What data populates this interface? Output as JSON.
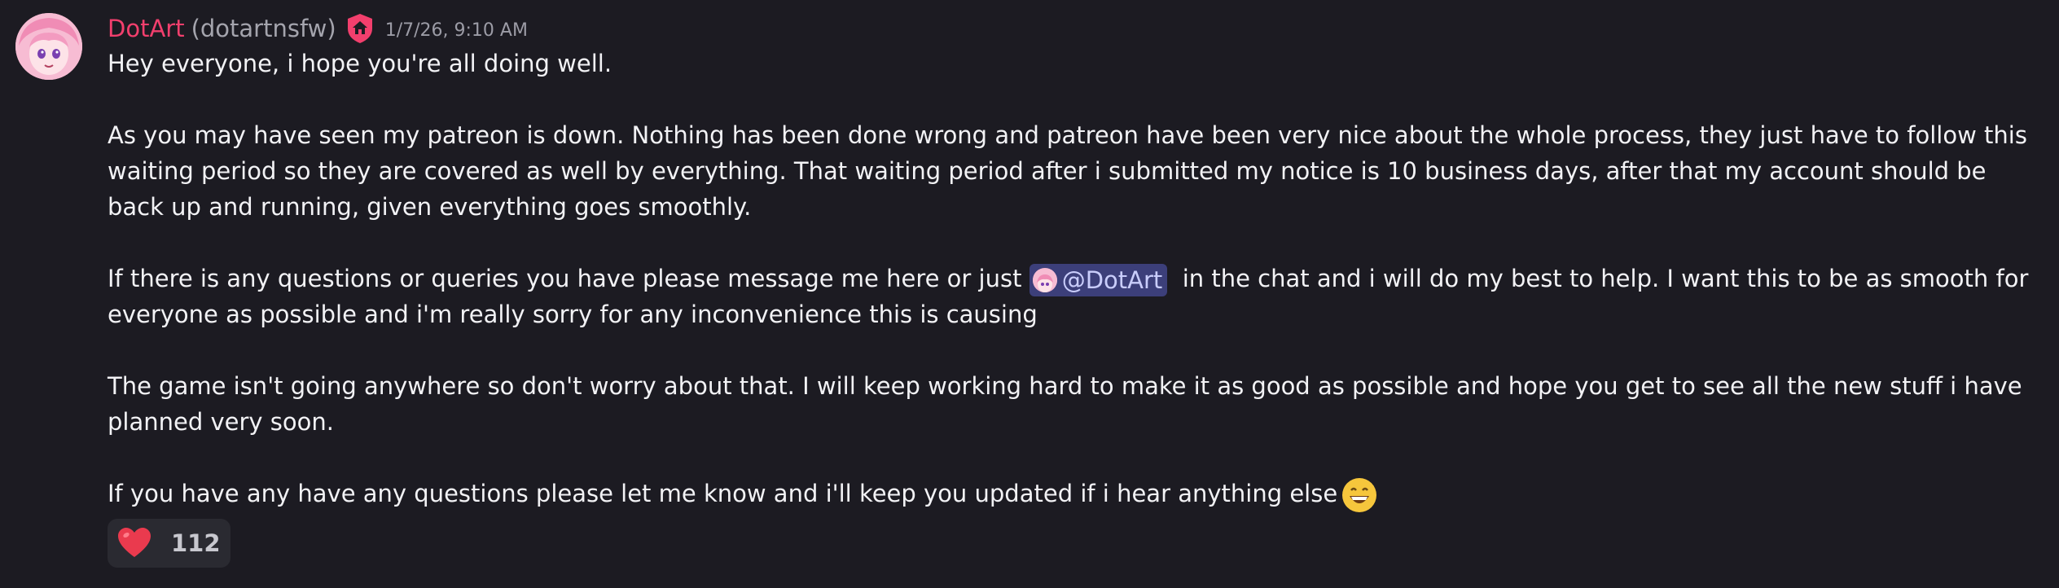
{
  "author": {
    "display_name": "DotArt",
    "username": "(dotartnsfw)",
    "badge_icon": "house-shield-icon",
    "timestamp": "1/7/26, 9:10 AM",
    "name_color": "#f23f6d"
  },
  "message": {
    "p1": "Hey everyone, i hope you're all doing well.",
    "p2": "As you may have seen my patreon is down. Nothing has been done wrong and patreon have been very nice about the whole process, they just have to follow this waiting period so they are covered as well by everything. That waiting period after i submitted my notice is 10 business days, after that my account should be back up and running, given everything goes smoothly.",
    "p3_before": "If there is any questions or queries you have please message me here or just ",
    "mention": "@DotArt",
    "p3_after": "  in the chat and i will do my best to help. I want this to be as smooth for everyone as possible and i'm really sorry for any inconvenience this is causing",
    "p4": "The game isn't going anywhere so don't worry about that. I will keep working hard to make it as good as possible and hope you get to see all the new stuff i have planned very soon.",
    "p5": "If you have any have any questions please let me know and i'll keep you updated if i hear anything else",
    "p5_emoji": "grinning-face-emoji"
  },
  "reaction": {
    "emoji": "red-heart-emoji",
    "count": "112"
  },
  "colors": {
    "background": "#1c1b22",
    "mention_bg": "#3c3f7a",
    "mention_text": "#c9cdfb"
  }
}
